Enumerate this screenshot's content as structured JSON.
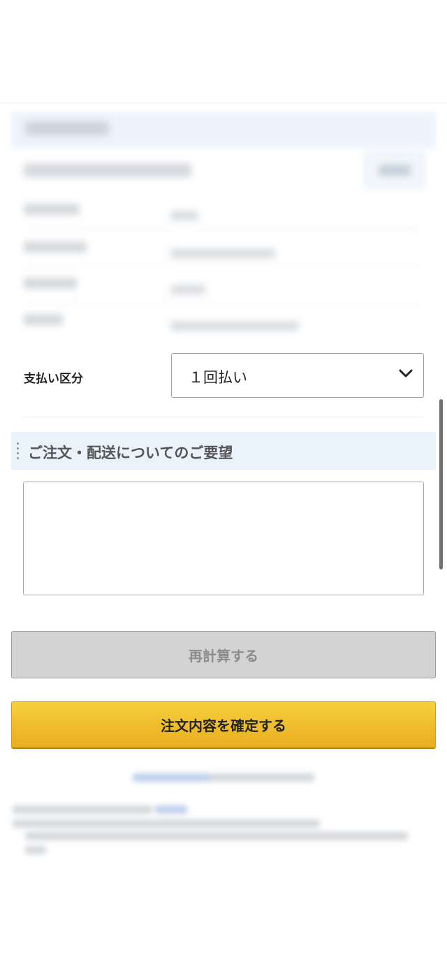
{
  "payment_division": {
    "label": "支払い区分",
    "selected_option": "１回払い"
  },
  "request_section": {
    "title": "ご注文・配送についてのご要望",
    "textarea_value": ""
  },
  "buttons": {
    "recalculate_label": "再計算する",
    "confirm_label": "注文内容を確定する"
  },
  "icons": {
    "select_arrow": "chevron-down-icon",
    "section_marker": "vertical-dots-icon"
  },
  "colors": {
    "confirm_button": "#f0be2e",
    "recalc_button_disabled": "#d3d3d3",
    "section_header_bg": "#eaf2fb"
  }
}
